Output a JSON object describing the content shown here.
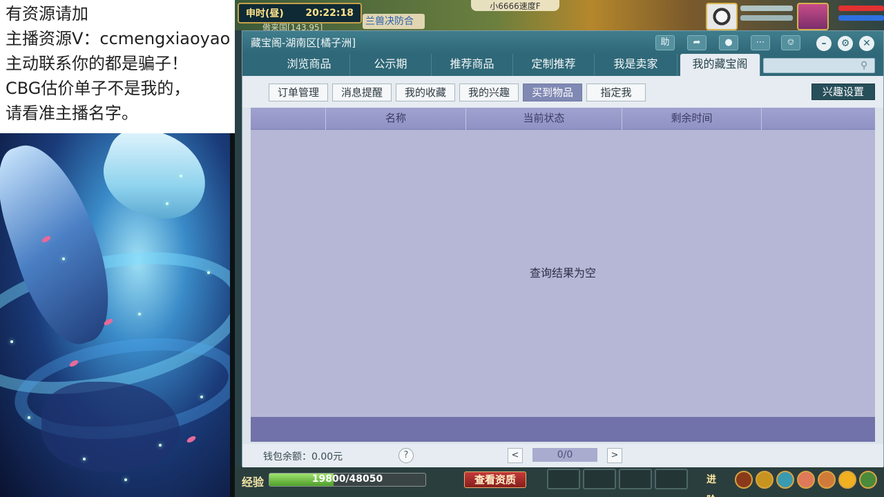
{
  "notes": {
    "lines": [
      "有资源请加",
      "主播资源V：ccmengxiaoyao",
      "主动联系你的都是骗子！",
      "CBG估价单子不是我的，",
      "请看准主播名字。"
    ]
  },
  "game": {
    "time_period": "申时(昼)",
    "clock": "20:22:18",
    "location": "傲来国[143,95]",
    "quest_text": "兰兽决防合",
    "speed_text": "小6666速度F"
  },
  "window": {
    "title": "藏宝阁-湖南区[橘子洲]",
    "toolbar": {
      "help_label": "助",
      "share_icon": "share-icon",
      "record_icon": "record-icon",
      "chat_icon": "chat-icon",
      "cart_icon": "cart-icon",
      "minimize_icon": "minimize-icon",
      "settings_icon": "gear-icon",
      "close_icon": "close-icon"
    },
    "tabs": [
      {
        "label": "浏览商品",
        "active": false
      },
      {
        "label": "公示期",
        "active": false
      },
      {
        "label": "推荐商品",
        "active": false
      },
      {
        "label": "定制推荐",
        "active": false
      },
      {
        "label": "我是卖家",
        "active": false
      },
      {
        "label": "我的藏宝阁",
        "active": true
      }
    ],
    "search": {
      "placeholder": "",
      "icon": "search-icon"
    },
    "subtabs": [
      {
        "label": "订单管理",
        "active": false
      },
      {
        "label": "消息提醒",
        "active": false
      },
      {
        "label": "我的收藏",
        "active": false
      },
      {
        "label": "我的兴趣",
        "active": false
      },
      {
        "label": "买到物品",
        "active": true
      },
      {
        "label": "指定我",
        "active": false
      }
    ],
    "interest_settings_label": "兴趣设置",
    "table": {
      "columns": [
        "",
        "名称",
        "当前状态",
        "剩余时间",
        ""
      ],
      "rows": [],
      "empty_message": "查询结果为空"
    },
    "footer": {
      "wallet_text": "钱包余额：0.00元",
      "help_label": "?",
      "prev_label": "<",
      "next_label": ">",
      "page_text": "0/0"
    }
  },
  "hud": {
    "exp_label": "经验",
    "exp_current": 19800,
    "exp_max": 48050,
    "exp_text": "19800/48050",
    "check_label": "查看资质",
    "rank_label": "进阶"
  }
}
